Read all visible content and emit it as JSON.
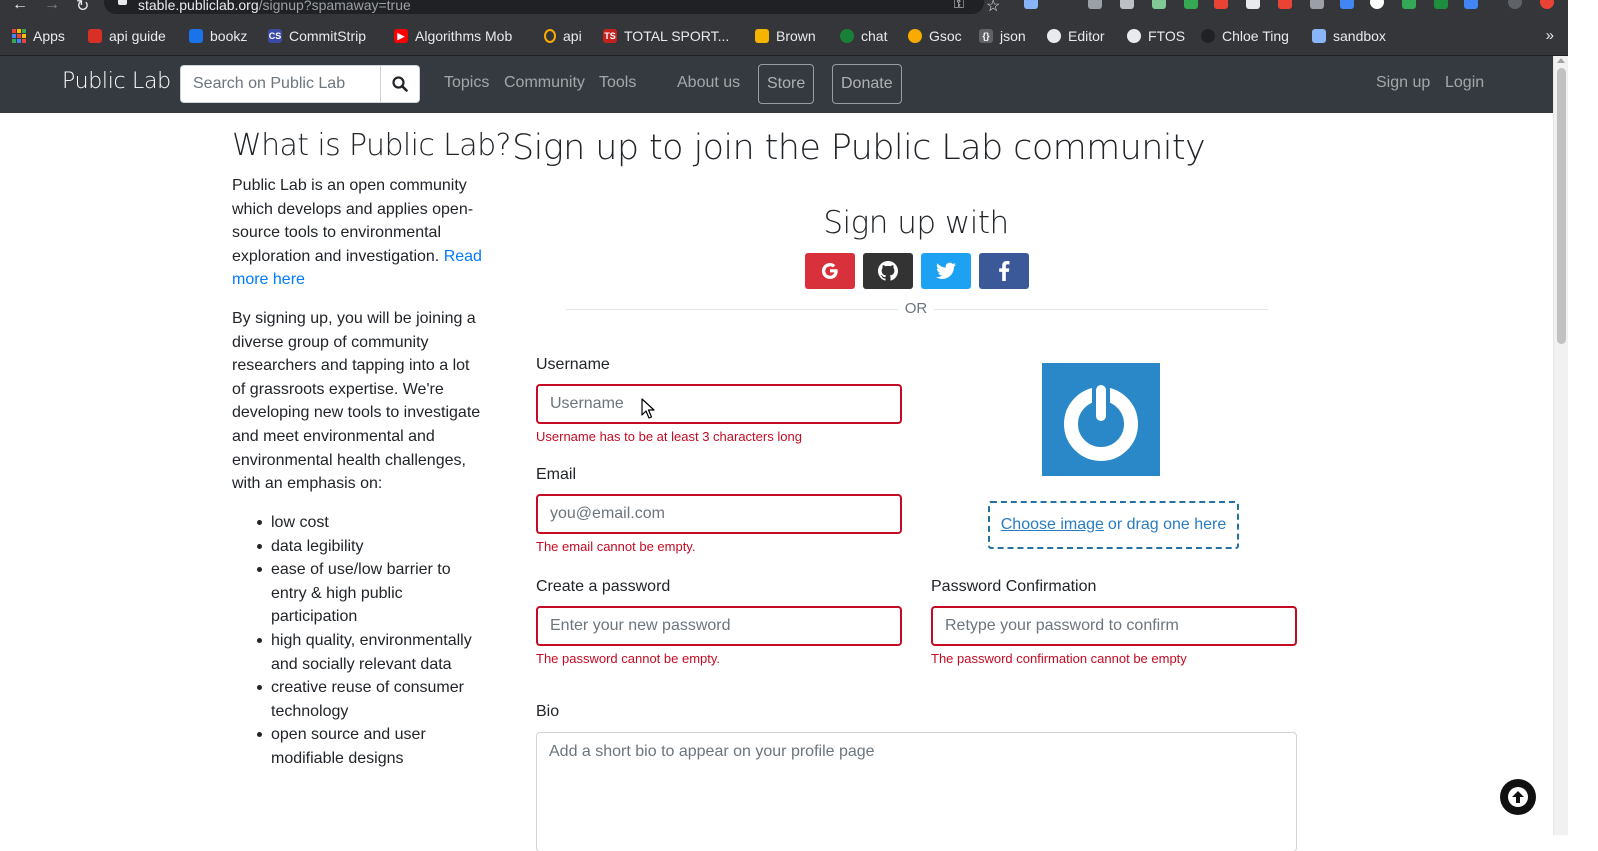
{
  "browser": {
    "url_host": "stable.publiclab.org",
    "url_path": "/signup?spamaway=true",
    "bookmarks": [
      {
        "label": "Apps",
        "color": "#ea4335"
      },
      {
        "label": "api guide",
        "color": "#d93025"
      },
      {
        "label": "bookz",
        "color": "#1a73e8"
      },
      {
        "label": "CommitStrip",
        "color": "#3c4aa6"
      },
      {
        "label": "Algorithms Mob",
        "color": "#ff0000"
      },
      {
        "label": "api",
        "color": "#f9ab00"
      },
      {
        "label": "TOTAL SPORT...",
        "color": "#c5221f"
      },
      {
        "label": "Brown",
        "color": "#f4b400"
      },
      {
        "label": "chat",
        "color": "#188038"
      },
      {
        "label": "Gsoc",
        "color": "#f9ab00"
      },
      {
        "label": "json",
        "color": "#5f6368"
      },
      {
        "label": "Editor",
        "color": "#24292e"
      },
      {
        "label": "FTOS",
        "color": "#24292e"
      },
      {
        "label": "Chloe Ting",
        "color": "#202124"
      },
      {
        "label": "sandbox",
        "color": "#8ab4f8"
      }
    ],
    "more": "»"
  },
  "navbar": {
    "brand": "Public Lab",
    "search_placeholder": "Search on Public Lab",
    "links": {
      "topics": "Topics",
      "community": "Community",
      "tools": "Tools",
      "about": "About us",
      "store": "Store",
      "donate": "Donate",
      "signup": "Sign up",
      "login": "Login"
    }
  },
  "sidebar": {
    "title": "What is Public Lab?",
    "intro": "Public Lab is an open community which develops and applies open-source tools to environmental exploration and investigation.",
    "read_more": "Read more here",
    "para2": "By signing up, you will be joining a diverse group of community researchers and tapping into a lot of grassroots expertise. We're developing new tools to investigate and meet environmental and environmental health challenges, with an emphasis on:",
    "emphasis": [
      "low cost",
      "data legibility",
      "ease of use/low barrier to entry & high public participation",
      "high quality, environmentally and socially relevant data",
      "creative reuse of consumer technology",
      "open source and user modifiable designs"
    ]
  },
  "main": {
    "title": "Sign up to join the Public Lab community",
    "signup_with": "Sign up with",
    "social": [
      {
        "name": "google",
        "color": "#d9313b"
      },
      {
        "name": "github",
        "color": "#333333"
      },
      {
        "name": "twitter",
        "color": "#1da1f2"
      },
      {
        "name": "facebook",
        "color": "#3b5998"
      }
    ],
    "or": "OR",
    "username": {
      "label": "Username",
      "placeholder": "Username",
      "error": "Username has to be at least 3 characters long"
    },
    "email": {
      "label": "Email",
      "placeholder": "you@email.com",
      "error": "The email cannot be empty."
    },
    "password": {
      "label": "Create a password",
      "placeholder": "Enter your new password",
      "error": "The password cannot be empty."
    },
    "password_confirm": {
      "label": "Password Confirmation",
      "placeholder": "Retype your password to confirm",
      "error": "The password confirmation cannot be empty"
    },
    "bio": {
      "label": "Bio",
      "placeholder": "Add a short bio to appear on your profile page"
    },
    "image": {
      "choose": "Choose image",
      "drag": "or drag one here"
    }
  },
  "colors": {
    "navbar": "#343a40",
    "error": "#c40b24",
    "link": "#007bff",
    "avatar": "#2a87c8"
  }
}
